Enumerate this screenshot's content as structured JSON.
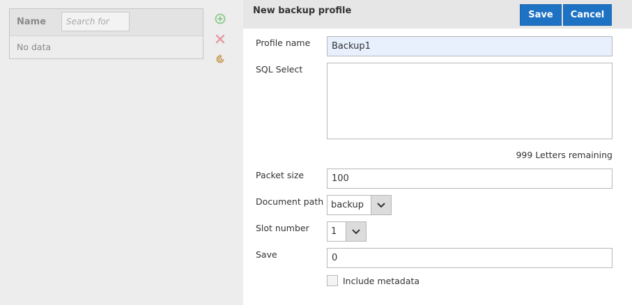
{
  "list": {
    "column_name": "Name",
    "search_placeholder": "Search for",
    "empty_text": "No data"
  },
  "side_icons": [
    "add-icon",
    "delete-icon",
    "refresh-icon"
  ],
  "form": {
    "title": "New backup profile",
    "save_label": "Save",
    "cancel_label": "Cancel",
    "profile_name_label": "Profile name",
    "profile_name_value": "Backup1",
    "sql_select_label": "SQL Select",
    "sql_select_value": "",
    "letters_remaining": "999 Letters remaining",
    "packet_size_label": "Packet size",
    "packet_size_value": "100",
    "document_path_label": "Document path",
    "document_path_value": "backup",
    "slot_number_label": "Slot number",
    "slot_number_value": "1",
    "save_field_label": "Save",
    "save_field_value": "0",
    "include_metadata_label": "Include metadata",
    "include_metadata_checked": false
  },
  "colors": {
    "accent": "#1e72c4",
    "add_icon": "#8cc98c",
    "delete_icon": "#e39aa3",
    "refresh_icon": "#c9a05e"
  }
}
